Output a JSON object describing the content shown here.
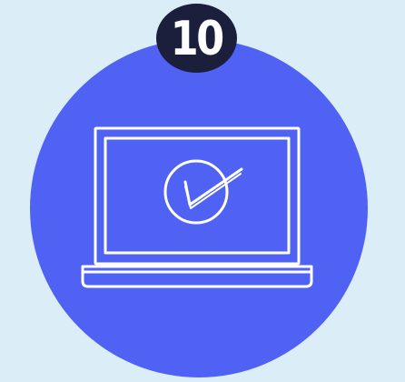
{
  "badge": {
    "number": "10"
  },
  "icon": {
    "name": "laptop-check-icon"
  },
  "colors": {
    "background": "#dbeef8",
    "circle": "#5062f3",
    "badge": "#1b1f3b",
    "line": "#ffffff"
  }
}
